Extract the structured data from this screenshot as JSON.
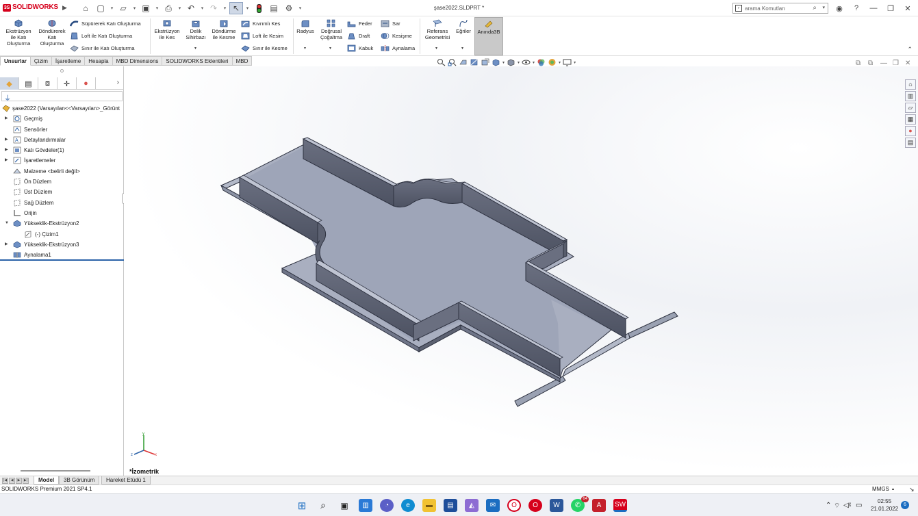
{
  "app": {
    "brand": "SOLIDWORKS",
    "document_title": "şase2022.SLDPRT *",
    "search_placeholder": "arama Komutları"
  },
  "ribbon": {
    "extrude_boss": [
      "Ekstrüzyon",
      "ile Katı",
      "Oluşturma"
    ],
    "revolve_boss": [
      "Döndürerek",
      "Katı",
      "Oluşturma"
    ],
    "sweep_boss": "Süpürerek Katı Oluşturma",
    "loft_boss": "Loft ile Katı Oluşturma",
    "boundary_boss": "Sınır ile Katı Oluşturma",
    "extrude_cut": [
      "Ekstrüzyon",
      "ile Kes"
    ],
    "hole_wizard": [
      "Delik",
      "Sihirbazı"
    ],
    "revolve_cut": [
      "Döndürme",
      "ile Kesme"
    ],
    "swept_cut": "Kıvrımlı Kes",
    "loft_cut": "Loft ile Kesim",
    "boundary_cut": "Sınır ile Kesme",
    "fillet": "Radyus",
    "linear_pattern": [
      "Doğrusal",
      "Çoğaltma"
    ],
    "rib": "Feder",
    "draft": "Draft",
    "shell": "Kabuk",
    "wrap": "Sar",
    "intersect": "Kesişme",
    "mirror": "Aynalama",
    "ref_geometry": [
      "Referans",
      "Geometrisi"
    ],
    "curves": "Eğriler",
    "instant3d": "Anında3B"
  },
  "command_tabs": [
    "Unsurlar",
    "Çizim",
    "İşaretleme",
    "Hesapla",
    "MBD Dimensions",
    "SOLIDWORKS Eklentileri",
    "MBD"
  ],
  "feature_tree": {
    "root": "şase2022  (Varsayılan<<Varsayılan>_Görünt",
    "items": [
      {
        "label": "Geçmiş",
        "expandable": true
      },
      {
        "label": "Sensörler",
        "expandable": false
      },
      {
        "label": "Detaylandırmalar",
        "expandable": true
      },
      {
        "label": "Katı Gövdeler(1)",
        "expandable": true
      },
      {
        "label": "İşaretlemeler",
        "expandable": true
      },
      {
        "label": "Malzeme <belirli değil>",
        "expandable": false
      },
      {
        "label": "Ön Düzlem",
        "expandable": false
      },
      {
        "label": "Üst Düzlem",
        "expandable": false
      },
      {
        "label": "Sağ Düzlem",
        "expandable": false
      },
      {
        "label": "Orijin",
        "expandable": false
      },
      {
        "label": "Yükseklik-Ekstrüzyon2",
        "expandable": true,
        "expanded": true
      },
      {
        "label": "(-) Çizim1",
        "expandable": false,
        "child": true
      },
      {
        "label": "Yükseklik-Ekstrüzyon3",
        "expandable": true
      },
      {
        "label": "Aynalama1",
        "expandable": false
      }
    ]
  },
  "viewport": {
    "view_label": "*İzometrik"
  },
  "bottom_tabs": [
    "Model",
    "3B Görünüm",
    "Hareket Etüdü 1"
  ],
  "status": {
    "text": "SOLIDWORKS Premium 2021 SP4.1",
    "units": "MMGS"
  },
  "taskbar": {
    "whatsapp_badge": "64",
    "time": "02:55",
    "date": "21.01.2022",
    "notifications": "6"
  },
  "colors": {
    "brand_red": "#d6001c",
    "part_face": "#a7aec0",
    "part_wall": "#5c6171",
    "selection_blue": "#2b62a8"
  }
}
